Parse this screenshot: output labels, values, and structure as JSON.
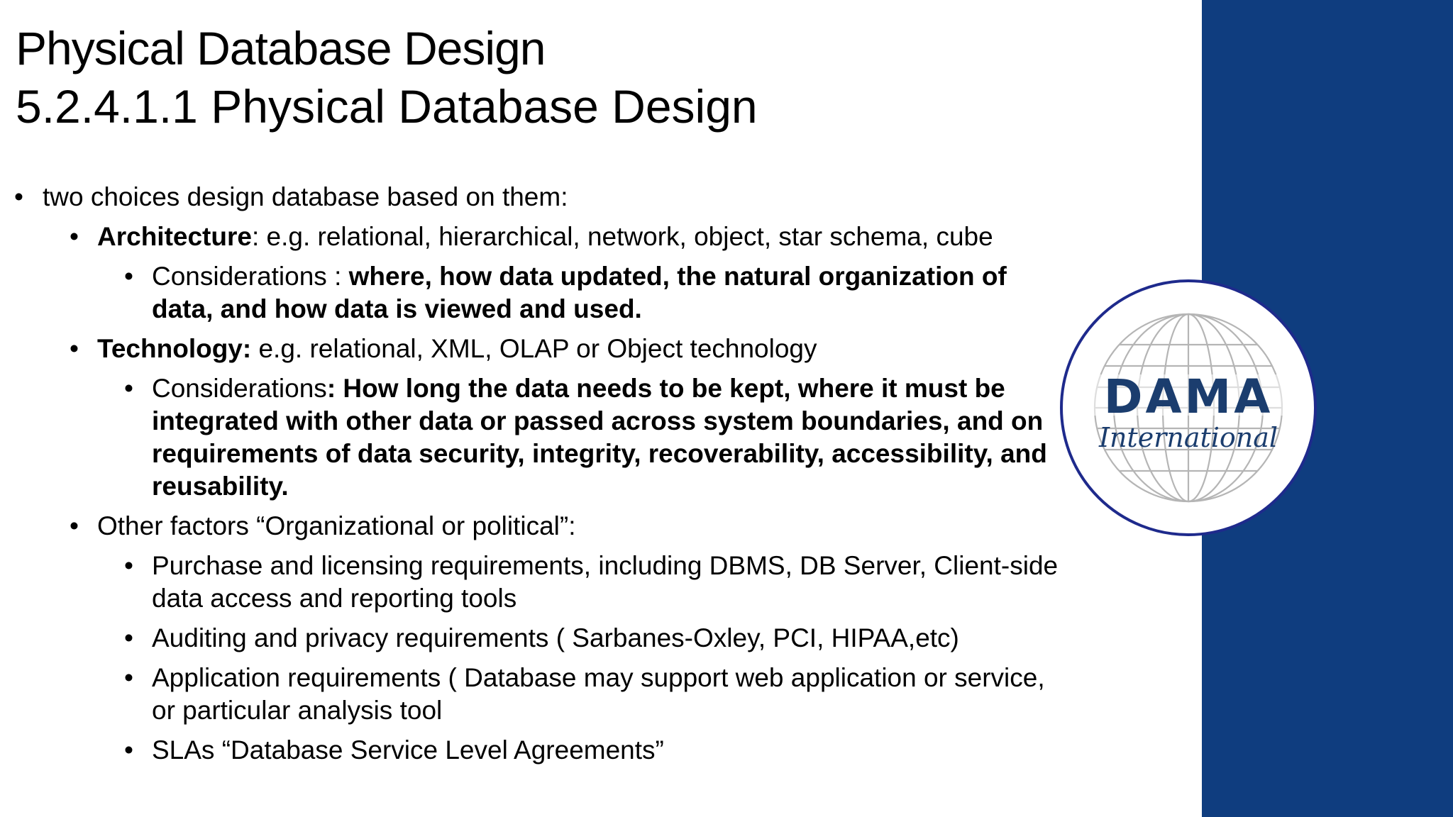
{
  "title": {
    "main": "Physical Database Design",
    "sub": "5.2.4.1.1 Physical Database Design"
  },
  "content": {
    "intro": "two choices design database based on them:",
    "architecture": {
      "label": "Architecture",
      "text": ": e.g. relational, hierarchical, network, object, star schema, cube",
      "consideration_prefix": "Considerations : ",
      "consideration_bold": "where, how data updated, the natural organization of data, and how data is viewed and used."
    },
    "technology": {
      "label": "Technology:",
      "text": " e.g. relational, XML, OLAP or Object technology",
      "consideration_prefix": "Considerations",
      "consideration_bold": ": How long the data needs to be kept, where it must be integrated with other data or passed across system boundaries, and on requirements of data security, integrity, recoverability, accessibility, and reusability."
    },
    "other_factors": {
      "label": "Other factors “Organizational or political”:",
      "items": [
        "Purchase and licensing requirements, including DBMS, DB Server, Client-side data access and reporting tools",
        "Auditing and privacy requirements ( Sarbanes-Oxley, PCI, HIPAA,etc)",
        "Application requirements ( Database may support web application or service, or particular analysis tool",
        "SLAs “Database Service Level Agreements”"
      ]
    }
  },
  "logo": {
    "name": "DAMA",
    "subtitle": "International",
    "color": "#1b3d6e"
  },
  "colors": {
    "side_band": "#0f3d7f",
    "logo_ring": "#1e2a8c"
  }
}
